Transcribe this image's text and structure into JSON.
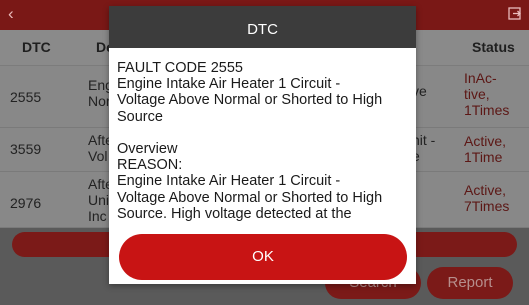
{
  "header": {
    "back_icon": "back-chevron-icon",
    "exit_icon": "exit-icon"
  },
  "table": {
    "columns": {
      "code": "DTC",
      "desc": "De",
      "status": "Status"
    },
    "rows": [
      {
        "code": "2555",
        "desc": "Engi\nNor",
        "sys": "ve",
        "status": "InAc-\ntive,\n1Times"
      },
      {
        "code": "3559",
        "desc": "Afte\nVol",
        "sys": "nit -\ne",
        "status": "Active,\n1Time"
      },
      {
        "code": "2976",
        "desc": "Afte\nUni\nInc",
        "sys": "",
        "status": "Active,\n7Times"
      }
    ]
  },
  "footer": {
    "search_label": "Search",
    "report_label": "Report"
  },
  "dialog": {
    "title": "DTC",
    "body": "FAULT CODE 2555\nEngine Intake Air Heater 1 Circuit -\nVoltage Above Normal or Shorted to High\nSource\n\nOverview\nREASON:\nEngine Intake Air Heater 1 Circuit -\nVoltage Above Normal or Shorted to High\nSource. High voltage detected at the",
    "ok_label": "OK"
  },
  "colors": {
    "dialog_header": "#3c3c3c",
    "ok_button": "#c81414",
    "brand_dark_red": "#7b1a18"
  }
}
